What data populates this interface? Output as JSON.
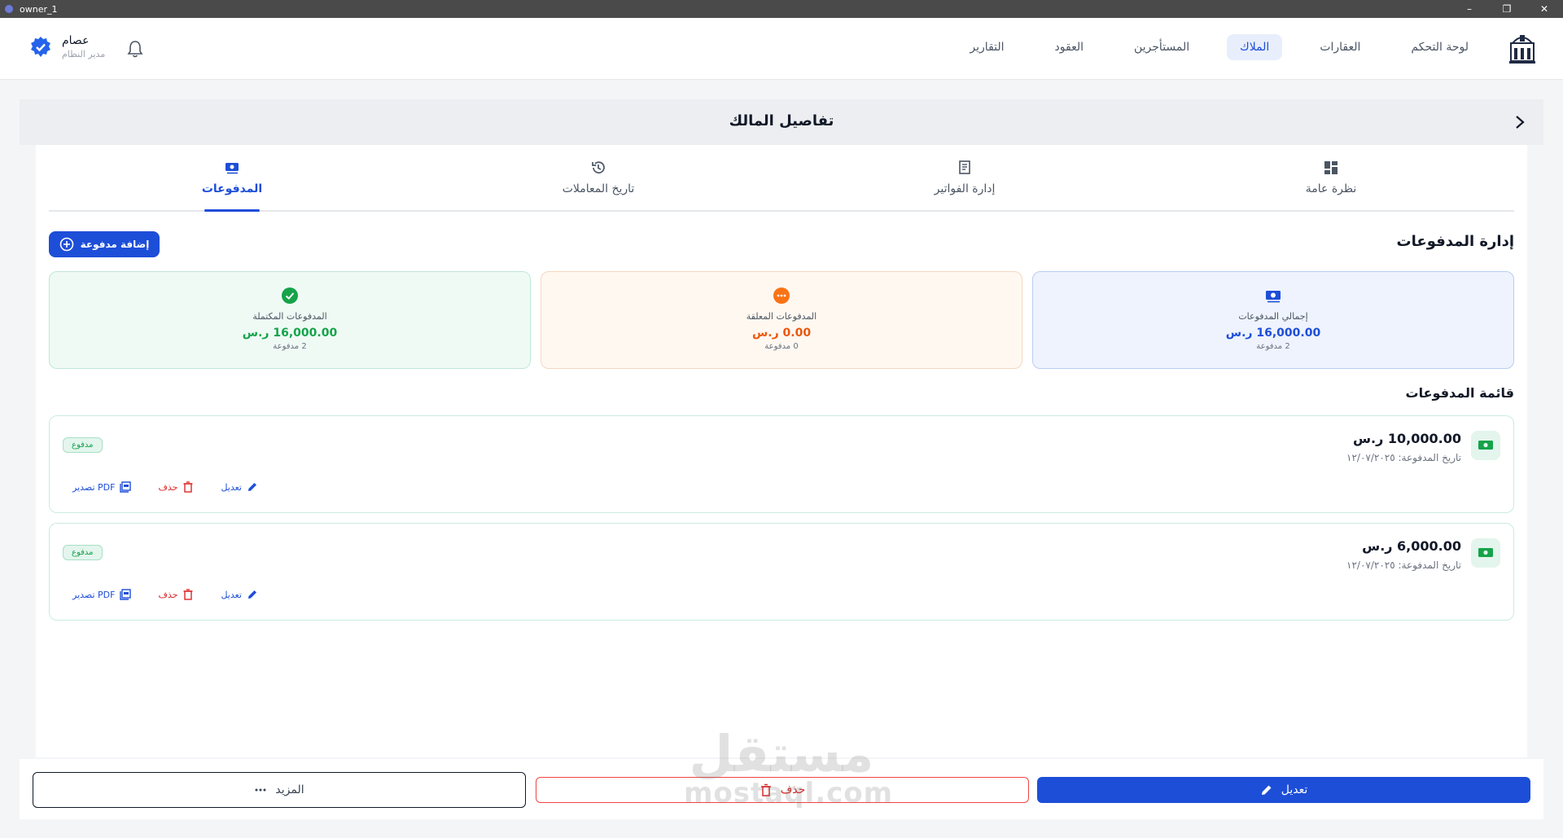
{
  "window": {
    "title": "owner_1"
  },
  "header": {
    "nav": [
      "لوحة التحكم",
      "العقارات",
      "الملاك",
      "المستأجرين",
      "العقود",
      "التقارير"
    ],
    "active_nav": "الملاك",
    "user": {
      "name": "عصام",
      "role": "مدير النظام"
    }
  },
  "page": {
    "title": "تفاصيل المالك"
  },
  "tabs": [
    {
      "label": "نظرة عامة",
      "icon": "dashboard-icon"
    },
    {
      "label": "إدارة الفواتير",
      "icon": "receipt-icon"
    },
    {
      "label": "تاريخ المعاملات",
      "icon": "history-icon"
    },
    {
      "label": "المدفوعات",
      "icon": "payments-icon",
      "active": true
    }
  ],
  "payments": {
    "section_title": "إدارة المدفوعات",
    "add_button": "إضافة مدفوعة",
    "stats": {
      "total": {
        "label": "إجمالي المدفوعات",
        "value": "16,000.00 ر.س",
        "count": "2 مدفوعة",
        "color": "#1d4ed8"
      },
      "pending": {
        "label": "المدفوعات المعلقة",
        "value": "0.00 ر.س",
        "count": "0 مدفوعة",
        "color": "#ea580c"
      },
      "completed": {
        "label": "المدفوعات المكتملة",
        "value": "16,000.00 ر.س",
        "count": "2 مدفوعة",
        "color": "#16a34a"
      }
    },
    "list_title": "قائمة المدفوعات",
    "items": [
      {
        "amount": "10,000.00 ر.س",
        "date": "تاريخ المدفوعة: ١٢/٠٧/٢٠٢٥",
        "status": "مدفوع",
        "edit": "تعديل",
        "delete": "حذف",
        "export": "تصدير PDF"
      },
      {
        "amount": "6,000.00 ر.س",
        "date": "تاريخ المدفوعة: ١٢/٠٧/٢٠٢٥",
        "status": "مدفوع",
        "edit": "تعديل",
        "delete": "حذف",
        "export": "تصدير PDF"
      }
    ]
  },
  "bottom_actions": {
    "edit": "تعديل",
    "delete": "حذف",
    "more": "المزيد"
  },
  "watermark": {
    "arabic": "مستقل",
    "latin": "mostaql.com"
  }
}
